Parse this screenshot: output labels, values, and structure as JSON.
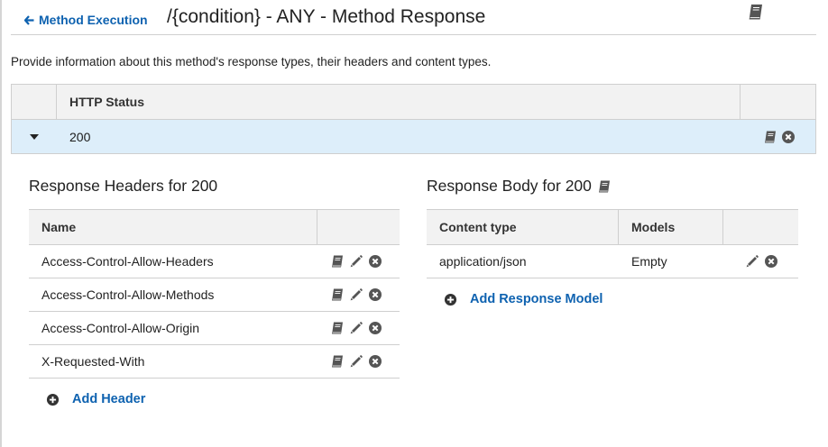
{
  "header": {
    "back_label": "Method Execution",
    "title": "/{condition} - ANY - Method Response"
  },
  "description": "Provide information about this method's response types, their headers and content types.",
  "status_table": {
    "column_label": "HTTP Status",
    "rows": [
      {
        "status": "200"
      }
    ]
  },
  "response_headers": {
    "title": "Response Headers for 200",
    "column_name": "Name",
    "rows": [
      {
        "name": "Access-Control-Allow-Headers"
      },
      {
        "name": "Access-Control-Allow-Methods"
      },
      {
        "name": "Access-Control-Allow-Origin"
      },
      {
        "name": "X-Requested-With"
      }
    ],
    "add_label": "Add Header"
  },
  "response_body": {
    "title": "Response Body for 200",
    "column_content_type": "Content type",
    "column_models": "Models",
    "rows": [
      {
        "content_type": "application/json",
        "model": "Empty"
      }
    ],
    "add_label": "Add Response Model"
  },
  "icons": {
    "back": "arrow-left-icon",
    "docs": "book-icon",
    "edit": "pencil-icon",
    "delete": "remove-circle-icon",
    "add": "plus-circle-icon",
    "expand": "caret-down-icon"
  },
  "colors": {
    "link": "#0e62b0",
    "selected_row": "#ddeefa",
    "header_bg": "#f2f2f2",
    "icon": "#555555"
  }
}
